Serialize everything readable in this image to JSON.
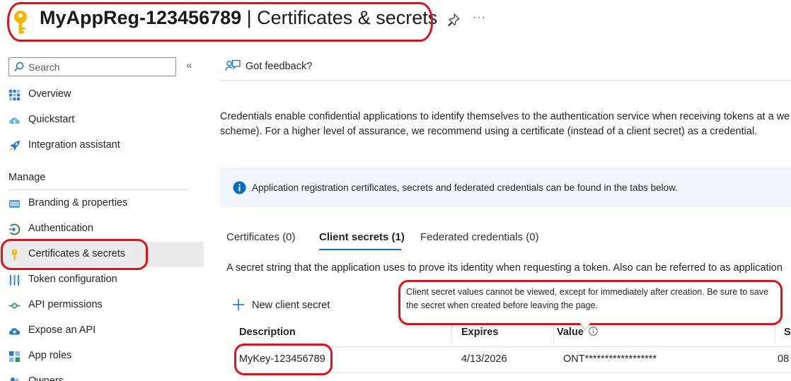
{
  "header": {
    "app_name": "MyAppReg-123456789",
    "separator": " | ",
    "page_name": "Certificates & secrets",
    "more_label": "···"
  },
  "sidebar": {
    "search_placeholder": "Search",
    "collapse_label": "«",
    "items_top": [
      {
        "label": "Overview",
        "icon": "overview-grid-icon"
      },
      {
        "label": "Quickstart",
        "icon": "cloud-lightning-icon"
      },
      {
        "label": "Integration assistant",
        "icon": "rocket-icon"
      }
    ],
    "manage_label": "Manage",
    "items_manage": [
      {
        "label": "Branding & properties",
        "icon": "branding-icon"
      },
      {
        "label": "Authentication",
        "icon": "authentication-icon"
      },
      {
        "label": "Certificates & secrets",
        "icon": "key-icon",
        "active": true
      },
      {
        "label": "Token configuration",
        "icon": "token-config-icon"
      },
      {
        "label": "API permissions",
        "icon": "api-permissions-icon"
      },
      {
        "label": "Expose an API",
        "icon": "cloud-api-icon"
      },
      {
        "label": "App roles",
        "icon": "app-roles-icon"
      },
      {
        "label": "Owners",
        "icon": "owners-icon"
      }
    ]
  },
  "main": {
    "feedback_label": "Got feedback?",
    "description_line1": "Credentials enable confidential applications to identify themselves to the authentication service when receiving tokens at a we",
    "description_line2": "scheme). For a higher level of assurance, we recommend using a certificate (instead of a client secret) as a credential.",
    "info_text": "Application registration certificates, secrets and federated credentials can be found in the tabs below.",
    "tabs": [
      {
        "label": "Certificates (0)"
      },
      {
        "label": "Client secrets (1)",
        "active": true
      },
      {
        "label": "Federated credentials (0)"
      }
    ],
    "secret_description": "A secret string that the application uses to prove its identity when requesting a token. Also can be referred to as application",
    "new_secret_label": "New client secret",
    "tooltip_text": "Client secret values cannot be viewed, except for immediately after creation. Be sure to save the secret when created before leaving the page.",
    "table": {
      "headers": [
        "Description",
        "Expires",
        "Value",
        "Se"
      ],
      "rows": [
        {
          "description": "MyKey-123456789",
          "expires": "4/13/2026",
          "value": "ONT******************",
          "secret_id": "08"
        }
      ]
    }
  },
  "colors": {
    "accent": "#0f6cbd",
    "highlight_ring": "#d9141b",
    "info_bg": "#eff6fc",
    "active_nav_bg": "#ececec",
    "key_gold": "#f2b705"
  }
}
